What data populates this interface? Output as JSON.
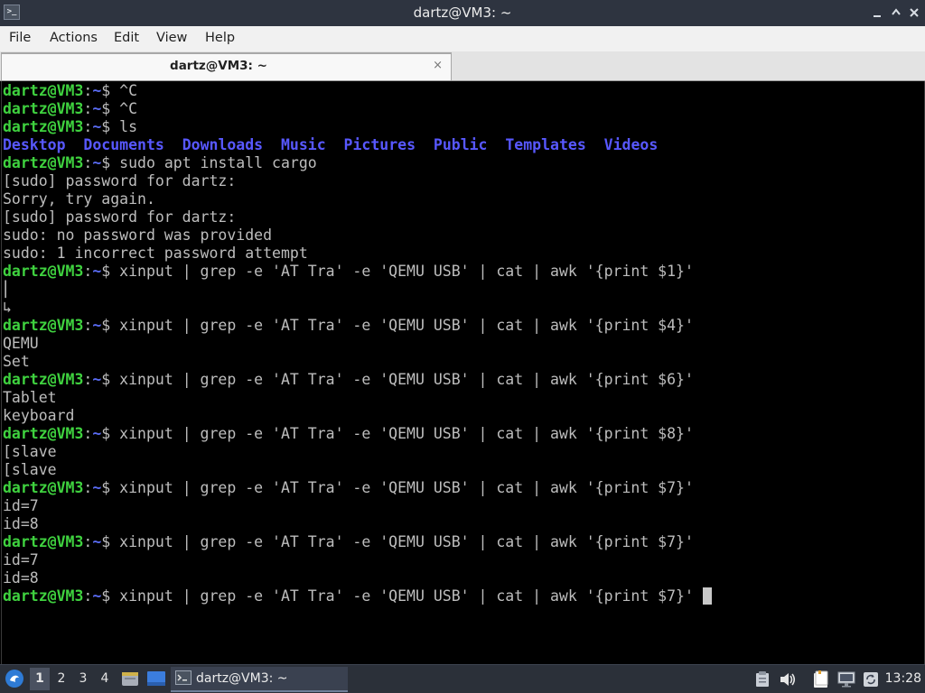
{
  "window": {
    "title": "dartz@VM3: ~",
    "app_icon": ">_",
    "minimize_icon": "minimize-icon",
    "maximize_icon": "maximize-icon",
    "close_icon": "close-icon"
  },
  "menu": {
    "items": [
      {
        "label": "File"
      },
      {
        "label": "Actions"
      },
      {
        "label": "Edit"
      },
      {
        "label": "View"
      },
      {
        "label": "Help"
      }
    ]
  },
  "tab": {
    "label": "dartz@VM3: ~",
    "close": "×"
  },
  "terminal": {
    "prompt": {
      "user": "dartz@VM3",
      "sep": ":",
      "path": "~",
      "dollar": "$ "
    },
    "lines": [
      {
        "type": "prompt",
        "cmd": "^C"
      },
      {
        "type": "prompt",
        "cmd": "^C"
      },
      {
        "type": "prompt",
        "cmd": "ls"
      },
      {
        "type": "dirs",
        "items": [
          "Desktop",
          "Documents",
          "Downloads",
          "Music",
          "Pictures",
          "Public",
          "Templates",
          "Videos"
        ]
      },
      {
        "type": "prompt",
        "cmd": "sudo apt install cargo"
      },
      {
        "type": "out",
        "text": "[sudo] password for dartz:"
      },
      {
        "type": "out",
        "text": "Sorry, try again."
      },
      {
        "type": "out",
        "text": "[sudo] password for dartz:"
      },
      {
        "type": "out",
        "text": "sudo: no password was provided"
      },
      {
        "type": "out",
        "text": "sudo: 1 incorrect password attempt"
      },
      {
        "type": "prompt",
        "cmd": "xinput | grep -e 'AT Tra' -e 'QEMU USB' | cat | awk '{print $1}'"
      },
      {
        "type": "out",
        "text": "⎜"
      },
      {
        "type": "out",
        "text": "↳"
      },
      {
        "type": "prompt",
        "cmd": "xinput | grep -e 'AT Tra' -e 'QEMU USB' | cat | awk '{print $4}'"
      },
      {
        "type": "out",
        "text": "QEMU"
      },
      {
        "type": "out",
        "text": "Set"
      },
      {
        "type": "prompt",
        "cmd": "xinput | grep -e 'AT Tra' -e 'QEMU USB' | cat | awk '{print $6}'"
      },
      {
        "type": "out",
        "text": "Tablet"
      },
      {
        "type": "out",
        "text": "keyboard"
      },
      {
        "type": "prompt",
        "cmd": "xinput | grep -e 'AT Tra' -e 'QEMU USB' | cat | awk '{print $8}'"
      },
      {
        "type": "out",
        "text": "[slave"
      },
      {
        "type": "out",
        "text": "[slave"
      },
      {
        "type": "prompt",
        "cmd": "xinput | grep -e 'AT Tra' -e 'QEMU USB' | cat | awk '{print $7}'"
      },
      {
        "type": "out",
        "text": "id=7"
      },
      {
        "type": "out",
        "text": "id=8"
      },
      {
        "type": "prompt",
        "cmd": "xinput | grep -e 'AT Tra' -e 'QEMU USB' | cat | awk '{print $7}'"
      },
      {
        "type": "out",
        "text": "id=7"
      },
      {
        "type": "out",
        "text": "id=8"
      },
      {
        "type": "prompt",
        "cmd": "xinput | grep -e 'AT Tra' -e 'QEMU USB' | cat | awk '{print $7}' ",
        "cursor": true
      }
    ]
  },
  "taskbar": {
    "start_icon": "start-menu-icon",
    "workspaces": [
      "1",
      "2",
      "3",
      "4"
    ],
    "active_workspace": "1",
    "file_manager_icon": "file-manager-icon",
    "show_desktop_icon": "show-desktop-icon",
    "task": {
      "label": "dartz@VM3: ~",
      "icon": "terminal-icon"
    },
    "tray": [
      "clipboard-icon",
      "volume-icon",
      "notes-icon",
      "network-icon",
      "sync-icon"
    ],
    "clock": "13:28"
  }
}
